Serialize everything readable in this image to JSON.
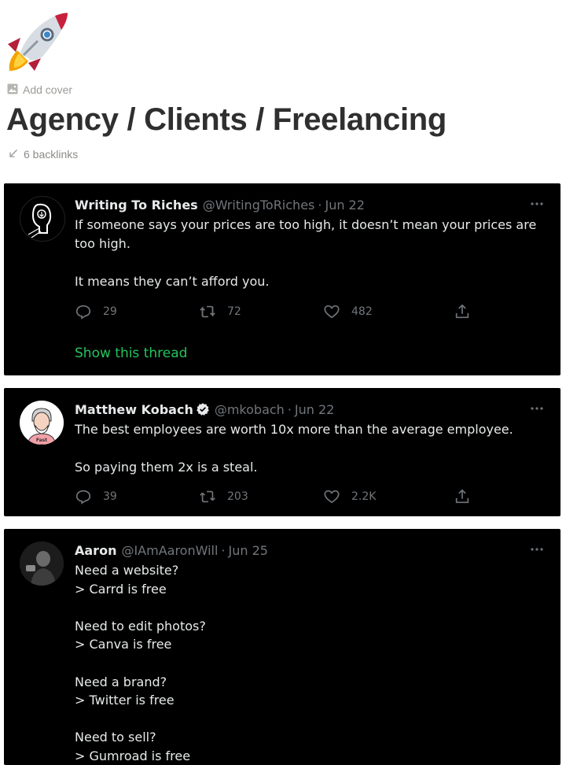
{
  "page": {
    "icon": "rocket-icon",
    "add_cover_label": "Add cover",
    "title": "Agency / Clients / Freelancing",
    "backlinks_label": "6 backlinks"
  },
  "colors": {
    "tweet_bg": "#000000",
    "tweet_text": "#e7e9ea",
    "muted": "#71767b",
    "show_thread": "#22c55e",
    "verified": "#1d9bf0"
  },
  "tweets": [
    {
      "name": "Writing To Riches",
      "handle": "@WritingToRiches",
      "separator": "·",
      "date": "Jun 22",
      "verified": false,
      "text": "If someone says your prices are too high, it doesn’t mean your prices are too high.\n\nIt means they can’t afford you.",
      "replies": "29",
      "retweets": "72",
      "likes": "482",
      "show_thread_label": "Show this thread"
    },
    {
      "name": "Matthew Kobach",
      "handle": "@mkobach",
      "separator": "·",
      "date": "Jun 22",
      "verified": true,
      "text": "The best employees are worth 10x more than the average employee.\n\nSo paying them 2x is a steal.",
      "replies": "39",
      "retweets": "203",
      "likes": "2.2K"
    },
    {
      "name": "Aaron",
      "handle": "@IAmAaronWill",
      "separator": "·",
      "date": "Jun 25",
      "verified": false,
      "text": "Need a website?\n> Carrd is free\n\nNeed to edit photos?\n> Canva is free\n\nNeed a brand?\n> Twitter is free\n\nNeed to sell?\n> Gumroad is free"
    }
  ]
}
